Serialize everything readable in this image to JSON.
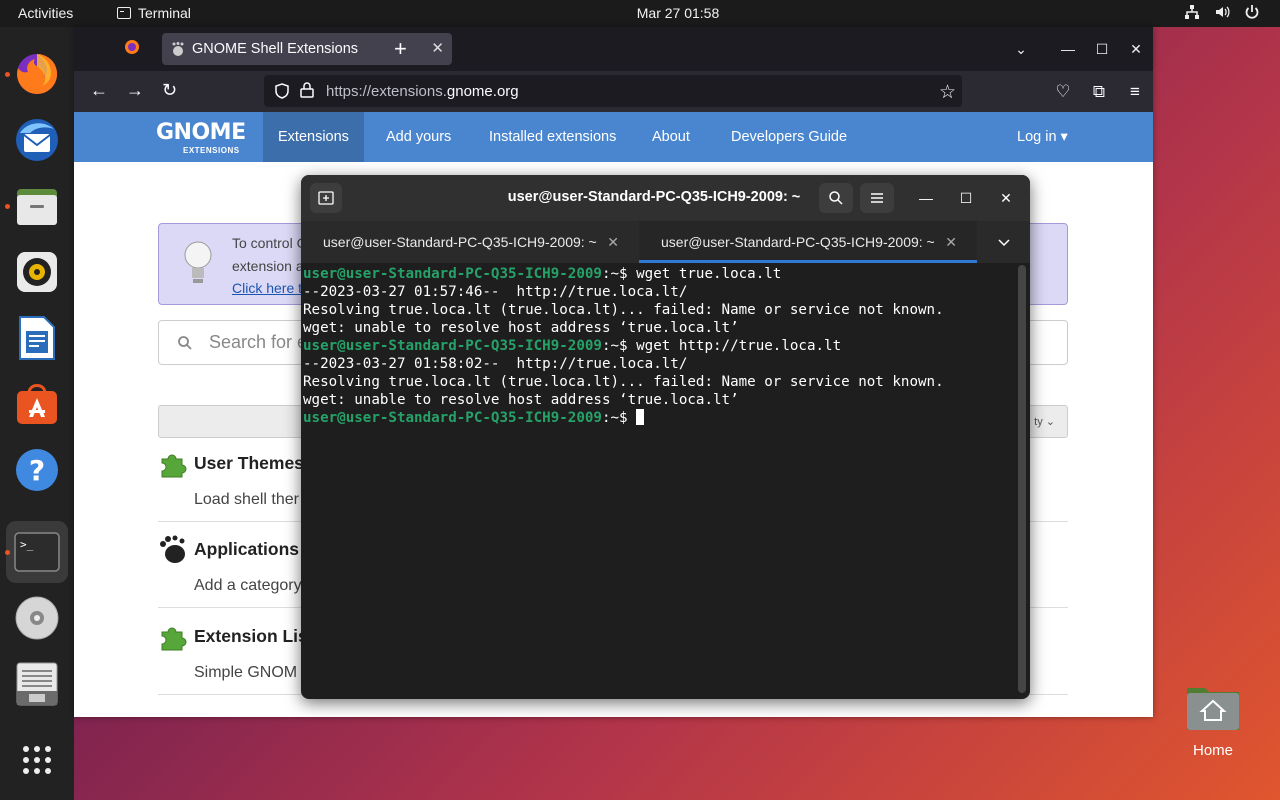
{
  "topbar": {
    "activities": "Activities",
    "app_name": "Terminal",
    "clock": "Mar 27  01:58"
  },
  "dock": {
    "items": [
      "firefox",
      "thunderbird",
      "files",
      "rhythmbox",
      "libreoffice-writer",
      "app-center",
      "help",
      "terminal",
      "optical-drive",
      "text-editor",
      "show-apps"
    ]
  },
  "desktop": {
    "home_label": "Home"
  },
  "firefox": {
    "tab_title": "GNOME Shell Extensions",
    "url_prefix": "https://extensions.",
    "url_domain": "gnome.org",
    "nav": {
      "logo_main": "GNOME",
      "logo_sub": "EXTENSIONS",
      "items": [
        "Extensions",
        "Add yours",
        "Installed extensions",
        "About",
        "Developers Guide"
      ],
      "login": "Log in ▾"
    },
    "banner": {
      "line1": "To control G",
      "line2": "extension a",
      "link": "Click here t"
    },
    "search_placeholder": "Search for e",
    "sort_label": "ty ⌄",
    "extensions": [
      {
        "title": "User Themes",
        "desc": "Load shell ther"
      },
      {
        "title": "Applications",
        "desc": "Add a category"
      },
      {
        "title": "Extension Lis",
        "desc": "Simple GNOM"
      }
    ]
  },
  "terminal": {
    "title": "user@user-Standard-PC-Q35-ICH9-2009: ~",
    "tabs": [
      {
        "label": "user@user-Standard-PC-Q35-ICH9-2009: ~",
        "active": false
      },
      {
        "label": "user@user-Standard-PC-Q35-ICH9-2009: ~",
        "active": true
      }
    ],
    "prompt": "user@user-Standard-PC-Q35-ICH9-2009",
    "lines": [
      {
        "type": "cmd",
        "path": ":~$ ",
        "text": "wget true.loca.lt"
      },
      {
        "type": "out",
        "text": "--2023-03-27 01:57:46--  http://true.loca.lt/"
      },
      {
        "type": "out",
        "text": "Resolving true.loca.lt (true.loca.lt)... failed: Name or service not known."
      },
      {
        "type": "out",
        "text": "wget: unable to resolve host address ‘true.loca.lt’"
      },
      {
        "type": "cmd",
        "path": ":~$ ",
        "text": "wget http://true.loca.lt"
      },
      {
        "type": "out",
        "text": "--2023-03-27 01:58:02--  http://true.loca.lt/"
      },
      {
        "type": "out",
        "text": "Resolving true.loca.lt (true.loca.lt)... failed: Name or service not known."
      },
      {
        "type": "out",
        "text": "wget: unable to resolve host address ‘true.loca.lt’"
      },
      {
        "type": "cmd",
        "path": ":~$ ",
        "text": ""
      }
    ]
  },
  "colors": {
    "prompt_green": "#26a269",
    "accent_orange": "#e95420",
    "gnome_blue": "#4a86cf",
    "tab_underline": "#2f79d5"
  }
}
